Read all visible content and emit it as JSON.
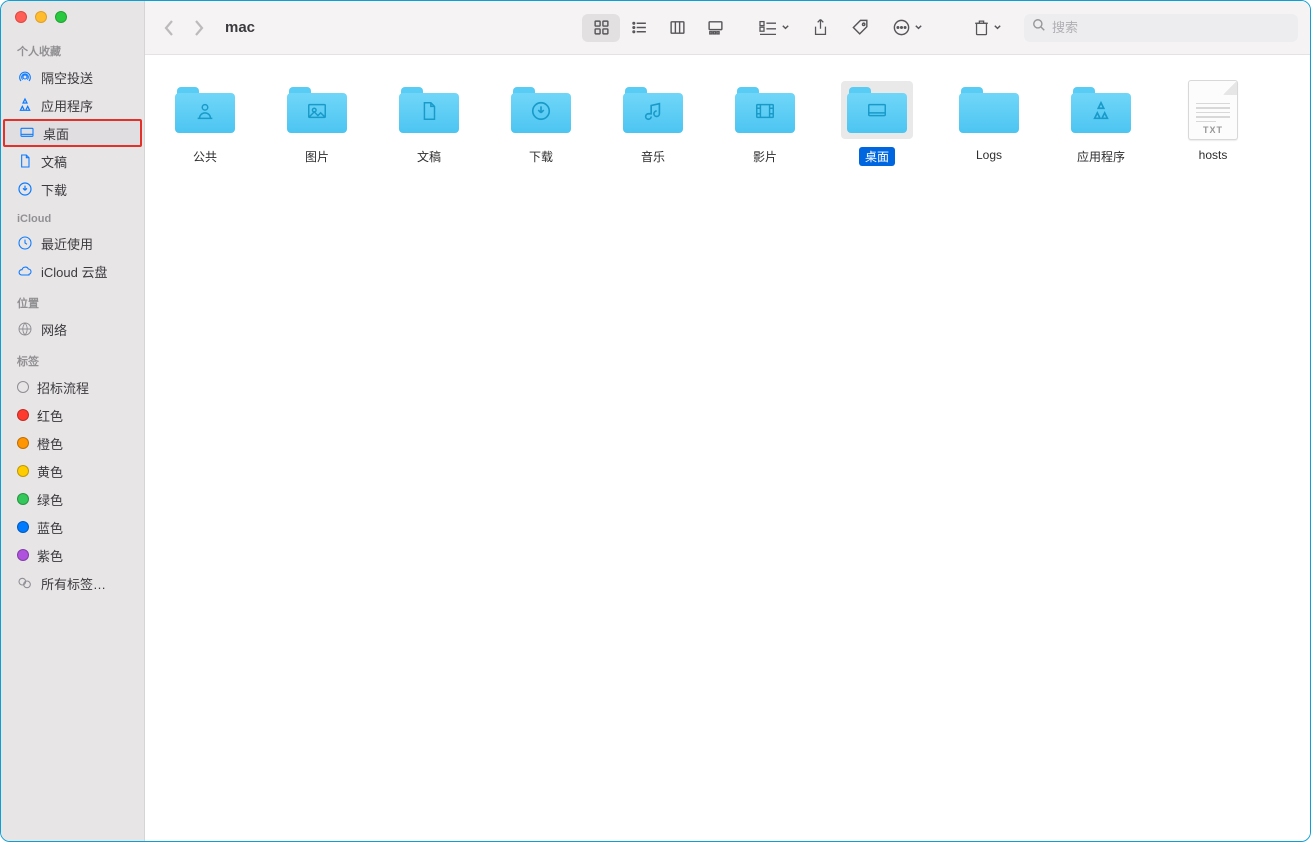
{
  "window": {
    "title": "mac"
  },
  "search": {
    "placeholder": "搜索"
  },
  "sidebar": {
    "sections": {
      "favorites": {
        "heading": "个人收藏",
        "items": [
          "隔空投送",
          "应用程序",
          "桌面",
          "文稿",
          "下载"
        ]
      },
      "icloud": {
        "heading": "iCloud",
        "items": [
          "最近使用",
          "iCloud 云盘"
        ]
      },
      "locations": {
        "heading": "位置",
        "items": [
          "网络"
        ]
      },
      "tags": {
        "heading": "标签",
        "items": [
          "招标流程",
          "红色",
          "橙色",
          "黄色",
          "绿色",
          "蓝色",
          "紫色",
          "所有标签…"
        ]
      }
    }
  },
  "content": {
    "items": [
      {
        "name": "公共",
        "type": "folder",
        "glyph": "public",
        "selected": false
      },
      {
        "name": "图片",
        "type": "folder",
        "glyph": "pictures",
        "selected": false
      },
      {
        "name": "文稿",
        "type": "folder",
        "glyph": "document",
        "selected": false
      },
      {
        "name": "下载",
        "type": "folder",
        "glyph": "download",
        "selected": false
      },
      {
        "name": "音乐",
        "type": "folder",
        "glyph": "music",
        "selected": false
      },
      {
        "name": "影片",
        "type": "folder",
        "glyph": "movies",
        "selected": false
      },
      {
        "name": "桌面",
        "type": "folder",
        "glyph": "desktop",
        "selected": true
      },
      {
        "name": "Logs",
        "type": "folder",
        "glyph": "plain",
        "selected": false
      },
      {
        "name": "应用程序",
        "type": "folder",
        "glyph": "apps",
        "selected": false
      },
      {
        "name": "hosts",
        "type": "txt",
        "ext": "TXT",
        "selected": false
      }
    ]
  }
}
